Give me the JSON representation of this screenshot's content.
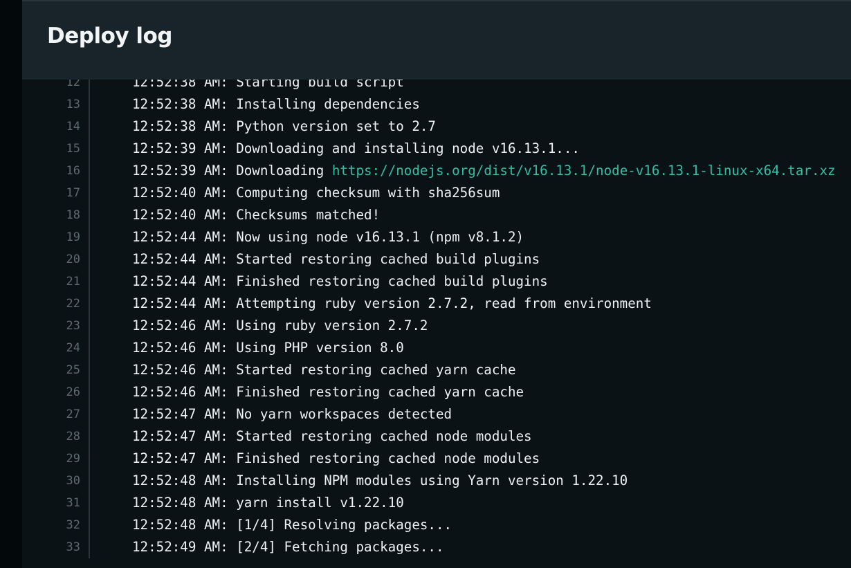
{
  "header": {
    "title": "Deploy log"
  },
  "log": {
    "lines": [
      {
        "no": "12",
        "time": "12:52:38 AM:",
        "text": "Starting build script"
      },
      {
        "no": "13",
        "time": "12:52:38 AM:",
        "text": "Installing dependencies"
      },
      {
        "no": "14",
        "time": "12:52:38 AM:",
        "text": "Python version set to 2.7"
      },
      {
        "no": "15",
        "time": "12:52:39 AM:",
        "text": "Downloading and installing node v16.13.1..."
      },
      {
        "no": "16",
        "time": "12:52:39 AM:",
        "text": "Downloading",
        "link": "https://nodejs.org/dist/v16.13.1/node-v16.13.1-linux-x64.tar.xz"
      },
      {
        "no": "17",
        "time": "12:52:40 AM:",
        "text": "Computing checksum with sha256sum"
      },
      {
        "no": "18",
        "time": "12:52:40 AM:",
        "text": "Checksums matched!"
      },
      {
        "no": "19",
        "time": "12:52:44 AM:",
        "text": "Now using node v16.13.1 (npm v8.1.2)"
      },
      {
        "no": "20",
        "time": "12:52:44 AM:",
        "text": "Started restoring cached build plugins"
      },
      {
        "no": "21",
        "time": "12:52:44 AM:",
        "text": "Finished restoring cached build plugins"
      },
      {
        "no": "22",
        "time": "12:52:44 AM:",
        "text": "Attempting ruby version 2.7.2, read from environment"
      },
      {
        "no": "23",
        "time": "12:52:46 AM:",
        "text": "Using ruby version 2.7.2"
      },
      {
        "no": "24",
        "time": "12:52:46 AM:",
        "text": "Using PHP version 8.0"
      },
      {
        "no": "25",
        "time": "12:52:46 AM:",
        "text": "Started restoring cached yarn cache"
      },
      {
        "no": "26",
        "time": "12:52:46 AM:",
        "text": "Finished restoring cached yarn cache"
      },
      {
        "no": "27",
        "time": "12:52:47 AM:",
        "text": "No yarn workspaces detected"
      },
      {
        "no": "28",
        "time": "12:52:47 AM:",
        "text": "Started restoring cached node modules"
      },
      {
        "no": "29",
        "time": "12:52:47 AM:",
        "text": "Finished restoring cached node modules"
      },
      {
        "no": "30",
        "time": "12:52:48 AM:",
        "text": "Installing NPM modules using Yarn version 1.22.10"
      },
      {
        "no": "31",
        "time": "12:52:48 AM:",
        "text": "yarn install v1.22.10"
      },
      {
        "no": "32",
        "time": "12:52:48 AM:",
        "text": "[1/4] Resolving packages..."
      },
      {
        "no": "33",
        "time": "12:52:49 AM:",
        "text": "[2/4] Fetching packages..."
      }
    ]
  },
  "colors": {
    "link": "#2fbfa4",
    "header_bg": "#19242a",
    "log_bg": "#0a1216",
    "line_number": "#5d6a70",
    "text": "#eef2f3"
  }
}
